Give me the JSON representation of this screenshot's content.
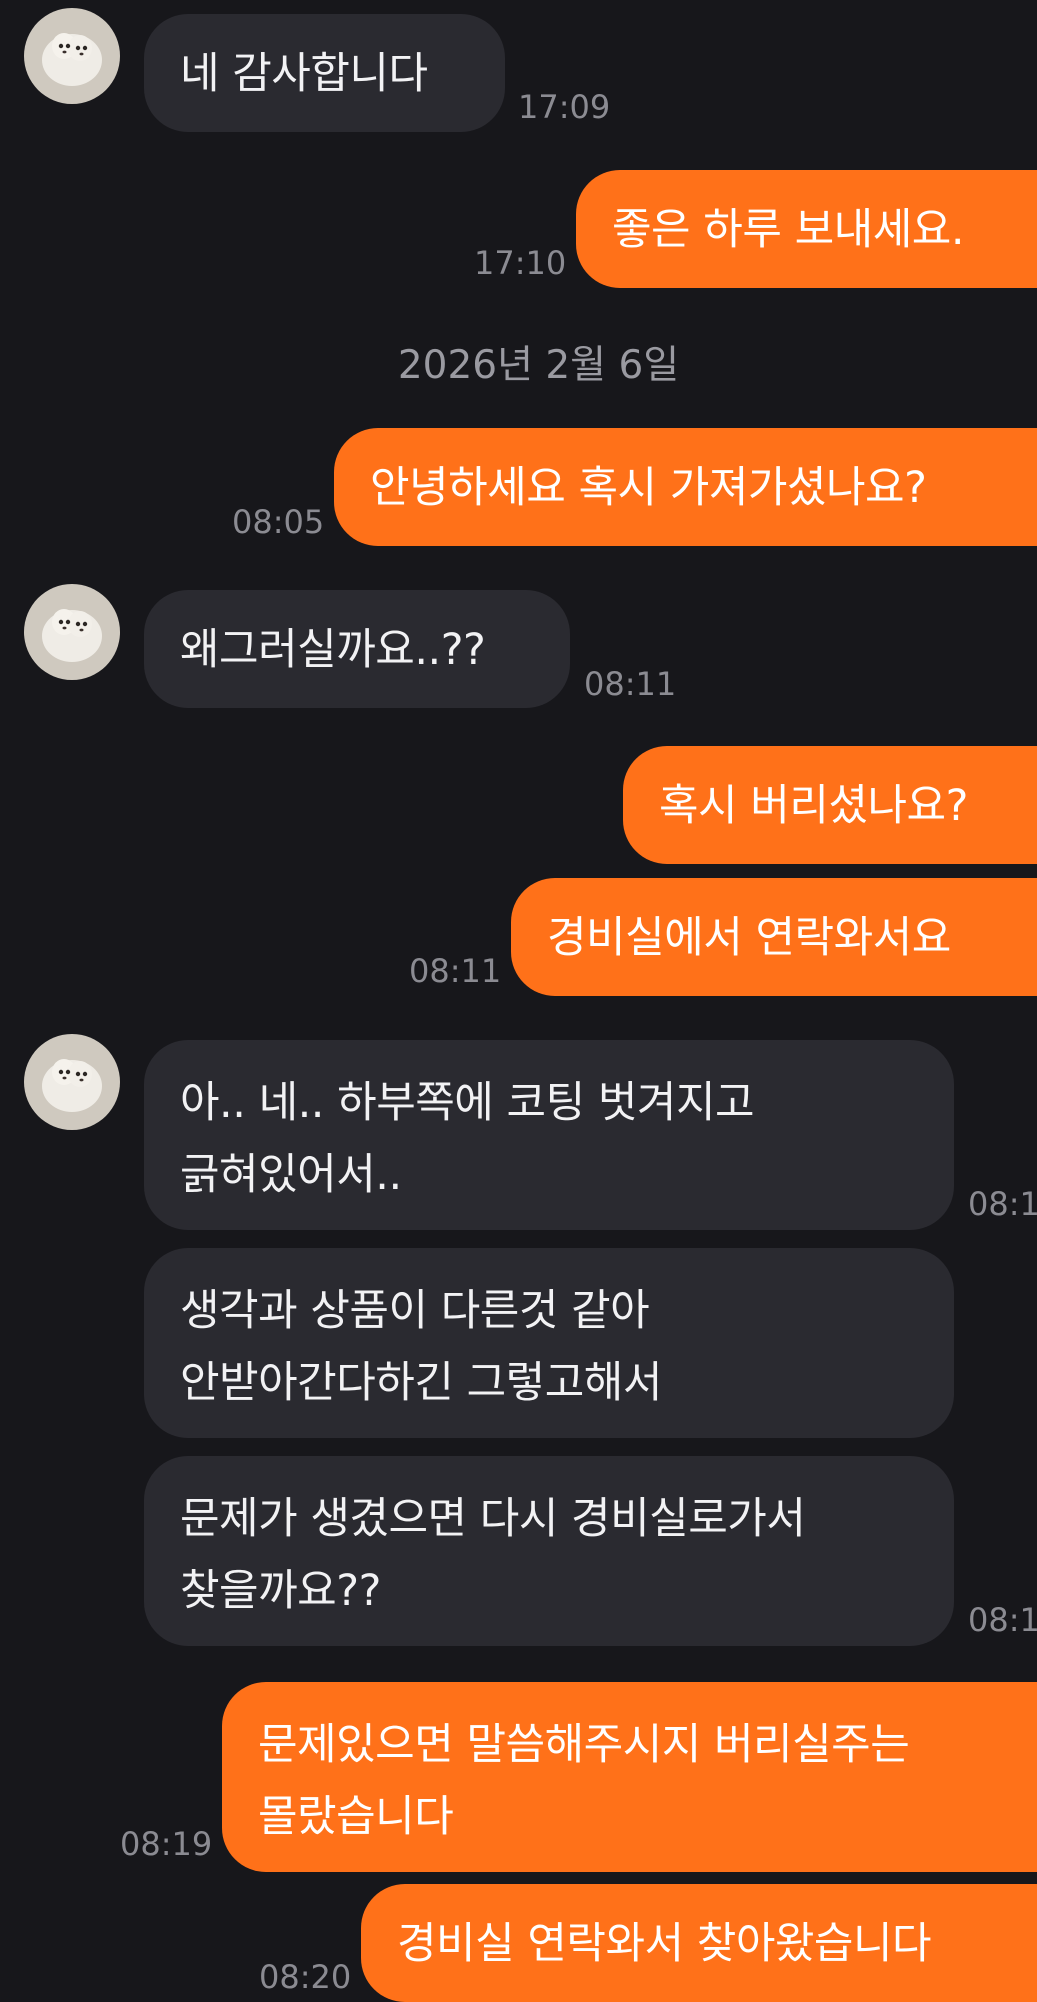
{
  "messages": [
    {
      "side": "in",
      "text": "네 감사합니다",
      "time": "17:09"
    },
    {
      "side": "out",
      "text": "좋은 하루 보내세요.",
      "time": "17:10"
    },
    {
      "side": "out",
      "text": "안녕하세요 혹시 가져가셨나요?",
      "time": "08:05"
    },
    {
      "side": "in",
      "text": "왜그러실까요..??",
      "time": "08:11"
    },
    {
      "side": "out",
      "text": "혹시 버리셨나요?"
    },
    {
      "side": "out",
      "text": "경비실에서 연락와서요",
      "time": "08:11"
    },
    {
      "side": "in",
      "lines": [
        "아.. 네.. 하부쪽에 코팅 벗겨지고",
        "긁혀있어서.."
      ],
      "time": "08:1"
    },
    {
      "side": "in",
      "lines": [
        "생각과 상품이 다른것 같아",
        "안받아간다하긴 그렇고해서"
      ]
    },
    {
      "side": "in",
      "lines": [
        "문제가 생겼으면 다시 경비실로가서",
        "찾을까요??"
      ],
      "time": "08:1"
    },
    {
      "side": "out",
      "lines": [
        "문제있으면 말씀해주시지 버리실주는",
        "몰랐습니다"
      ],
      "time": "08:19"
    },
    {
      "side": "out",
      "text": "경비실 연락와서 찾아왔습니다",
      "time": "08:20"
    }
  ],
  "date_separator": "2026년 2월 6일",
  "colors": {
    "background": "#17171b",
    "incoming_bubble": "#2a2a30",
    "outgoing_bubble": "#ff7119",
    "timestamp": "#8b8b92"
  },
  "avatar_icon": "puppy-profile-avatar-icon"
}
